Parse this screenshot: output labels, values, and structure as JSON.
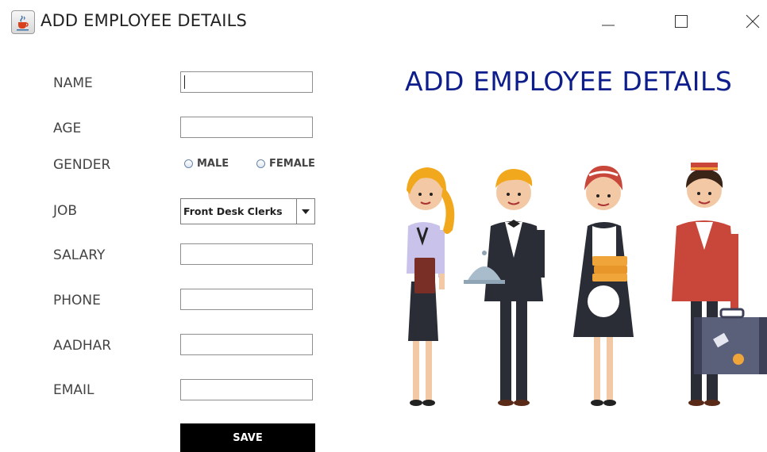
{
  "window": {
    "title": "ADD EMPLOYEE DETAILS",
    "icon": "java-cup-icon"
  },
  "form": {
    "name_label": "NAME",
    "age_label": "AGE",
    "gender_label": "GENDER",
    "gender_options": [
      "MALE",
      "FEMALE"
    ],
    "job_label": "JOB",
    "job_selected": "Front Desk Clerks",
    "salary_label": "SALARY",
    "phone_label": "PHONE",
    "aadhar_label": "AADHAR",
    "email_label": "EMAIL",
    "save_label": "SAVE"
  },
  "heading": "ADD EMPLOYEE DETAILS",
  "colors": {
    "heading": "#0d1e8c",
    "save_button": "#000000"
  }
}
